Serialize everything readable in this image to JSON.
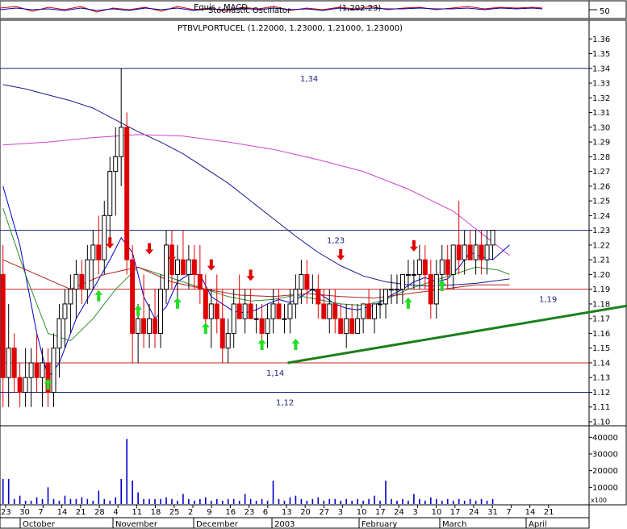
{
  "top_panel": {
    "overlapping_labels": [
      "Equis - MACD",
      "Stochastic Oscillator",
      "(1,202.23)"
    ],
    "right_value": "50"
  },
  "chart_data": {
    "type": "candlestick",
    "title": "PTBVLPORTUCEL (1.22000, 1.23000, 1.21000, 1.23000)",
    "ylim": [
      1.1,
      1.37
    ],
    "y_ticks": [
      "1.36",
      "1.35",
      "1.34",
      "1.33",
      "1.32",
      "1.31",
      "1.30",
      "1.29",
      "1.28",
      "1.27",
      "1.26",
      "1.25",
      "1.24",
      "1.23",
      "1.22",
      "1.21",
      "1.20",
      "1.19",
      "1.18",
      "1.17",
      "1.16",
      "1.15",
      "1.14",
      "1.13",
      "1.12",
      "1.11",
      "1.10"
    ],
    "x_ticks": [
      "23",
      "30",
      "7",
      "14",
      "21",
      "28",
      "4",
      "11",
      "18",
      "25",
      "2",
      "9",
      "16",
      "23",
      "6",
      "13",
      "20",
      "27",
      "3",
      "10",
      "17",
      "24",
      "3",
      "10",
      "17",
      "24",
      "31",
      "7",
      "14",
      "21"
    ],
    "month_labels": [
      "October",
      "November",
      "December",
      "2003",
      "February",
      "March",
      "April"
    ],
    "horizontal_levels": [
      {
        "value": 1.34,
        "label": "1,34",
        "color": "#1a237e"
      },
      {
        "value": 1.23,
        "label": "1,23",
        "color": "#1a237e"
      },
      {
        "value": 1.19,
        "label": "1,19",
        "color": "#c62828"
      },
      {
        "value": 1.14,
        "label": "1,14",
        "color": "#c62828"
      },
      {
        "value": 1.12,
        "label": "1,12",
        "color": "#1a237e"
      }
    ],
    "trendline": {
      "from": [
        47,
        1.14
      ],
      "to": [
        115,
        1.187
      ],
      "color": "#1b7f1b"
    },
    "candles": [
      [
        1.2,
        1.22,
        1.11,
        1.13,
        0
      ],
      [
        1.13,
        1.18,
        1.11,
        1.15,
        1
      ],
      [
        1.15,
        1.16,
        1.12,
        1.13,
        0
      ],
      [
        1.13,
        1.14,
        1.11,
        1.12,
        0
      ],
      [
        1.12,
        1.15,
        1.11,
        1.13,
        1
      ],
      [
        1.13,
        1.15,
        1.11,
        1.14,
        1
      ],
      [
        1.14,
        1.16,
        1.12,
        1.13,
        0
      ],
      [
        1.13,
        1.15,
        1.11,
        1.14,
        1
      ],
      [
        1.14,
        1.15,
        1.11,
        1.12,
        0
      ],
      [
        1.12,
        1.16,
        1.11,
        1.15,
        1
      ],
      [
        1.15,
        1.18,
        1.13,
        1.17,
        1
      ],
      [
        1.17,
        1.19,
        1.15,
        1.18,
        1
      ],
      [
        1.18,
        1.2,
        1.16,
        1.19,
        1
      ],
      [
        1.19,
        1.21,
        1.17,
        1.2,
        1
      ],
      [
        1.2,
        1.21,
        1.18,
        1.19,
        0
      ],
      [
        1.19,
        1.22,
        1.18,
        1.21,
        1
      ],
      [
        1.21,
        1.23,
        1.19,
        1.22,
        1
      ],
      [
        1.22,
        1.24,
        1.2,
        1.21,
        0
      ],
      [
        1.21,
        1.25,
        1.2,
        1.24,
        1
      ],
      [
        1.24,
        1.28,
        1.22,
        1.27,
        1
      ],
      [
        1.27,
        1.3,
        1.24,
        1.28,
        1
      ],
      [
        1.28,
        1.34,
        1.26,
        1.3,
        1
      ],
      [
        1.3,
        1.31,
        1.2,
        1.21,
        0
      ],
      [
        1.21,
        1.22,
        1.14,
        1.16,
        0
      ],
      [
        1.16,
        1.18,
        1.14,
        1.17,
        1
      ],
      [
        1.17,
        1.2,
        1.15,
        1.16,
        0
      ],
      [
        1.16,
        1.18,
        1.15,
        1.17,
        1
      ],
      [
        1.17,
        1.19,
        1.15,
        1.16,
        0
      ],
      [
        1.16,
        1.2,
        1.15,
        1.19,
        1
      ],
      [
        1.19,
        1.23,
        1.18,
        1.22,
        1
      ],
      [
        1.22,
        1.23,
        1.19,
        1.2,
        0
      ],
      [
        1.2,
        1.22,
        1.18,
        1.21,
        1
      ],
      [
        1.21,
        1.23,
        1.2,
        1.2,
        0
      ],
      [
        1.2,
        1.22,
        1.19,
        1.21,
        1
      ],
      [
        1.21,
        1.22,
        1.19,
        1.2,
        0
      ],
      [
        1.2,
        1.22,
        1.18,
        1.19,
        0
      ],
      [
        1.19,
        1.2,
        1.16,
        1.17,
        0
      ],
      [
        1.17,
        1.19,
        1.15,
        1.18,
        1
      ],
      [
        1.18,
        1.2,
        1.16,
        1.17,
        0
      ],
      [
        1.17,
        1.19,
        1.14,
        1.15,
        0
      ],
      [
        1.15,
        1.17,
        1.14,
        1.16,
        1
      ],
      [
        1.16,
        1.19,
        1.15,
        1.18,
        1
      ],
      [
        1.18,
        1.2,
        1.17,
        1.17,
        0
      ],
      [
        1.17,
        1.19,
        1.16,
        1.18,
        1
      ],
      [
        1.18,
        1.19,
        1.17,
        1.17,
        0
      ],
      [
        1.17,
        1.18,
        1.16,
        1.17,
        1
      ],
      [
        1.17,
        1.18,
        1.15,
        1.16,
        0
      ],
      [
        1.16,
        1.18,
        1.15,
        1.17,
        1
      ],
      [
        1.17,
        1.19,
        1.16,
        1.18,
        1
      ],
      [
        1.18,
        1.19,
        1.17,
        1.17,
        0
      ],
      [
        1.17,
        1.18,
        1.16,
        1.17,
        1
      ],
      [
        1.17,
        1.19,
        1.16,
        1.18,
        1
      ],
      [
        1.18,
        1.2,
        1.17,
        1.19,
        1
      ],
      [
        1.19,
        1.21,
        1.18,
        1.2,
        1
      ],
      [
        1.2,
        1.21,
        1.18,
        1.19,
        0
      ],
      [
        1.19,
        1.2,
        1.18,
        1.19,
        1
      ],
      [
        1.19,
        1.2,
        1.17,
        1.18,
        0
      ],
      [
        1.18,
        1.19,
        1.17,
        1.17,
        0
      ],
      [
        1.17,
        1.19,
        1.16,
        1.18,
        1
      ],
      [
        1.18,
        1.19,
        1.16,
        1.17,
        0
      ],
      [
        1.17,
        1.18,
        1.16,
        1.16,
        0
      ],
      [
        1.16,
        1.18,
        1.15,
        1.17,
        1
      ],
      [
        1.17,
        1.18,
        1.16,
        1.16,
        0
      ],
      [
        1.16,
        1.18,
        1.16,
        1.17,
        1
      ],
      [
        1.17,
        1.18,
        1.16,
        1.18,
        1
      ],
      [
        1.18,
        1.19,
        1.17,
        1.17,
        0
      ],
      [
        1.17,
        1.18,
        1.16,
        1.18,
        1
      ],
      [
        1.18,
        1.19,
        1.17,
        1.18,
        1
      ],
      [
        1.18,
        1.19,
        1.17,
        1.19,
        1
      ],
      [
        1.19,
        1.2,
        1.18,
        1.19,
        1
      ],
      [
        1.19,
        1.2,
        1.18,
        1.19,
        1
      ],
      [
        1.19,
        1.2,
        1.18,
        1.2,
        1
      ],
      [
        1.2,
        1.21,
        1.19,
        1.2,
        1
      ],
      [
        1.2,
        1.21,
        1.19,
        1.2,
        1
      ],
      [
        1.2,
        1.22,
        1.19,
        1.21,
        1
      ],
      [
        1.21,
        1.22,
        1.19,
        1.2,
        0
      ],
      [
        1.2,
        1.21,
        1.17,
        1.18,
        0
      ],
      [
        1.18,
        1.21,
        1.17,
        1.2,
        1
      ],
      [
        1.2,
        1.22,
        1.19,
        1.21,
        1
      ],
      [
        1.21,
        1.22,
        1.19,
        1.2,
        0
      ],
      [
        1.2,
        1.22,
        1.19,
        1.22,
        1
      ],
      [
        1.22,
        1.25,
        1.2,
        1.21,
        0
      ],
      [
        1.21,
        1.23,
        1.2,
        1.22,
        1
      ],
      [
        1.22,
        1.23,
        1.21,
        1.21,
        0
      ],
      [
        1.21,
        1.23,
        1.2,
        1.22,
        1
      ],
      [
        1.22,
        1.23,
        1.2,
        1.21,
        0
      ],
      [
        1.21,
        1.23,
        1.2,
        1.22,
        1
      ],
      [
        1.22,
        1.23,
        1.21,
        1.23,
        1
      ]
    ],
    "series": [
      {
        "color": "#1a1a8c",
        "points": [
          [
            0,
            1.329
          ],
          [
            4,
            1.326
          ],
          [
            8,
            1.322
          ],
          [
            12,
            1.318
          ],
          [
            16,
            1.313
          ],
          [
            20,
            1.305
          ],
          [
            24,
            1.297
          ],
          [
            28,
            1.29
          ],
          [
            32,
            1.282
          ],
          [
            36,
            1.272
          ],
          [
            40,
            1.262
          ],
          [
            44,
            1.25
          ],
          [
            48,
            1.238
          ],
          [
            52,
            1.226
          ],
          [
            56,
            1.215
          ],
          [
            60,
            1.206
          ],
          [
            64,
            1.199
          ],
          [
            68,
            1.195
          ],
          [
            72,
            1.193
          ],
          [
            76,
            1.192
          ],
          [
            80,
            1.193
          ],
          [
            84,
            1.194
          ],
          [
            88,
            1.196
          ],
          [
            90,
            1.197
          ]
        ]
      },
      {
        "color": "#cc44cc",
        "points": [
          [
            0,
            1.288
          ],
          [
            8,
            1.29
          ],
          [
            16,
            1.293
          ],
          [
            24,
            1.295
          ],
          [
            32,
            1.294
          ],
          [
            40,
            1.29
          ],
          [
            48,
            1.285
          ],
          [
            56,
            1.278
          ],
          [
            64,
            1.27
          ],
          [
            72,
            1.258
          ],
          [
            80,
            1.243
          ],
          [
            86,
            1.225
          ],
          [
            90,
            1.213
          ]
        ]
      },
      {
        "color": "#0000cc",
        "points": [
          [
            0,
            1.26
          ],
          [
            3,
            1.22
          ],
          [
            6,
            1.16
          ],
          [
            8,
            1.13
          ],
          [
            10,
            1.14
          ],
          [
            13,
            1.17
          ],
          [
            16,
            1.19
          ],
          [
            19,
            1.21
          ],
          [
            21,
            1.225
          ],
          [
            23,
            1.215
          ],
          [
            25,
            1.185
          ],
          [
            27,
            1.17
          ],
          [
            29,
            1.178
          ],
          [
            31,
            1.195
          ],
          [
            33,
            1.2
          ],
          [
            35,
            1.2
          ],
          [
            37,
            1.185
          ],
          [
            39,
            1.18
          ],
          [
            41,
            1.175
          ],
          [
            43,
            1.174
          ],
          [
            45,
            1.176
          ],
          [
            47,
            1.18
          ],
          [
            49,
            1.183
          ],
          [
            51,
            1.181
          ],
          [
            53,
            1.185
          ],
          [
            55,
            1.19
          ],
          [
            57,
            1.185
          ],
          [
            59,
            1.18
          ],
          [
            61,
            1.177
          ],
          [
            63,
            1.176
          ],
          [
            65,
            1.178
          ],
          [
            67,
            1.181
          ],
          [
            69,
            1.186
          ],
          [
            71,
            1.19
          ],
          [
            73,
            1.195
          ],
          [
            75,
            1.198
          ],
          [
            77,
            1.195
          ],
          [
            79,
            1.197
          ],
          [
            81,
            1.205
          ],
          [
            83,
            1.215
          ],
          [
            85,
            1.212
          ],
          [
            87,
            1.21
          ],
          [
            90,
            1.22
          ]
        ]
      },
      {
        "color": "#2f8f2f",
        "points": [
          [
            0,
            1.245
          ],
          [
            4,
            1.2
          ],
          [
            8,
            1.16
          ],
          [
            12,
            1.155
          ],
          [
            16,
            1.17
          ],
          [
            20,
            1.19
          ],
          [
            24,
            1.205
          ],
          [
            28,
            1.2
          ],
          [
            32,
            1.195
          ],
          [
            36,
            1.19
          ],
          [
            40,
            1.185
          ],
          [
            44,
            1.182
          ],
          [
            48,
            1.183
          ],
          [
            52,
            1.186
          ],
          [
            56,
            1.183
          ],
          [
            60,
            1.18
          ],
          [
            64,
            1.179
          ],
          [
            68,
            1.183
          ],
          [
            72,
            1.19
          ],
          [
            76,
            1.195
          ],
          [
            80,
            1.2
          ],
          [
            84,
            1.205
          ],
          [
            88,
            1.203
          ],
          [
            90,
            1.2
          ]
        ]
      },
      {
        "color": "#b22222",
        "points": [
          [
            0,
            1.21
          ],
          [
            6,
            1.2
          ],
          [
            12,
            1.19
          ],
          [
            18,
            1.2
          ],
          [
            24,
            1.205
          ],
          [
            30,
            1.195
          ],
          [
            36,
            1.19
          ],
          [
            42,
            1.186
          ],
          [
            48,
            1.185
          ],
          [
            54,
            1.187
          ],
          [
            60,
            1.185
          ],
          [
            66,
            1.184
          ],
          [
            72,
            1.187
          ],
          [
            78,
            1.19
          ],
          [
            84,
            1.193
          ],
          [
            90,
            1.193
          ]
        ]
      }
    ],
    "up_arrows": [
      [
        8,
        1.125
      ],
      [
        17,
        1.185
      ],
      [
        24,
        1.175
      ],
      [
        31,
        1.18
      ],
      [
        36,
        1.163
      ],
      [
        46,
        1.152
      ],
      [
        52,
        1.152
      ],
      [
        72,
        1.18
      ],
      [
        78,
        1.192
      ]
    ],
    "down_arrows": [
      [
        19,
        1.222
      ],
      [
        26,
        1.218
      ],
      [
        30,
        1.213
      ],
      [
        37,
        1.207
      ],
      [
        44,
        1.2
      ],
      [
        60,
        1.214
      ],
      [
        73,
        1.22
      ]
    ],
    "volume": {
      "y_ticks": [
        "40000",
        "30000",
        "20000",
        "10000"
      ],
      "ylim": [
        0,
        44000
      ],
      "unit_label": "x100",
      "values": [
        15000,
        15000,
        3000,
        5000,
        2000,
        2000,
        4000,
        3000,
        10000,
        3000,
        2000,
        5000,
        3000,
        3000,
        4000,
        3000,
        2000,
        8000,
        3000,
        2000,
        4000,
        15000,
        39000,
        14000,
        7000,
        3000,
        3000,
        3000,
        3000,
        4000,
        3000,
        2000,
        6000,
        3000,
        2000,
        3000,
        4000,
        2000,
        3000,
        2000,
        3000,
        3000,
        2000,
        6000,
        3000,
        2000,
        3000,
        2000,
        14000,
        3000,
        2000,
        4000,
        5000,
        3000,
        2000,
        3000,
        4000,
        2000,
        3000,
        3000,
        2000,
        3000,
        2000,
        3000,
        2000,
        3000,
        5000,
        2000,
        14000,
        3000,
        2000,
        3000,
        2000,
        6000,
        3000,
        2000,
        4000,
        3000,
        2000,
        3000,
        2000,
        3000,
        2000,
        3000,
        2000,
        3000,
        2000,
        3000
      ]
    }
  }
}
